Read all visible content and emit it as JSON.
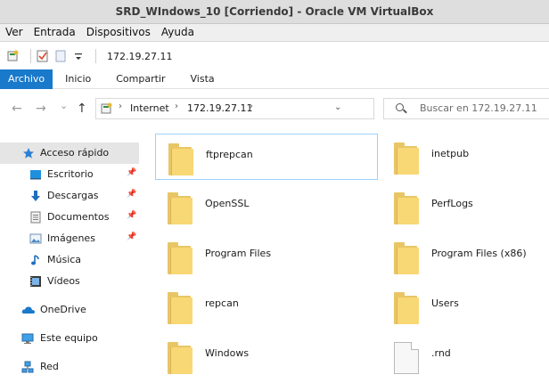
{
  "window": {
    "title": "SRD_WIndows_10 [Corriendo] - Oracle VM VirtualBox"
  },
  "vbox_menu": [
    "Ver",
    "Entrada",
    "Dispositivos",
    "Ayuda"
  ],
  "quick_access": {
    "title": "172.19.27.11",
    "icons": [
      "properties-icon",
      "checkmark-icon",
      "new-folder-icon",
      "customize-dropdown-icon"
    ]
  },
  "ribbon": {
    "tabs": [
      "Archivo",
      "Inicio",
      "Compartir",
      "Vista"
    ],
    "active": "Archivo"
  },
  "navigation": {
    "back": "←",
    "forward": "→",
    "dropdown": "⌄",
    "up": "↑",
    "refresh": "↻"
  },
  "address": {
    "crumbs": [
      "Internet",
      "172.19.27.11"
    ],
    "separator": "›"
  },
  "search": {
    "placeholder": "Buscar en 172.19.27.11"
  },
  "sidebar": {
    "items": [
      {
        "label": "Acceso rápido",
        "icon": "star-icon",
        "selected": true,
        "pinned": false
      },
      {
        "label": "Escritorio",
        "icon": "desktop-icon",
        "pinned": true
      },
      {
        "label": "Descargas",
        "icon": "download-icon",
        "pinned": true
      },
      {
        "label": "Documentos",
        "icon": "documents-icon",
        "pinned": true
      },
      {
        "label": "Imágenes",
        "icon": "pictures-icon",
        "pinned": true
      },
      {
        "label": "Música",
        "icon": "music-icon",
        "pinned": false
      },
      {
        "label": "Vídeos",
        "icon": "videos-icon",
        "pinned": false
      },
      {
        "label": "OneDrive",
        "icon": "cloud-icon",
        "pinned": false
      },
      {
        "label": "Este equipo",
        "icon": "computer-icon",
        "pinned": false
      },
      {
        "label": "Red",
        "icon": "network-icon",
        "pinned": false
      }
    ],
    "pin_glyph": "📌"
  },
  "files": [
    {
      "name": "ftprepcan",
      "type": "folder",
      "focused": true
    },
    {
      "name": "inetpub",
      "type": "folder"
    },
    {
      "name": "OpenSSL",
      "type": "folder"
    },
    {
      "name": "PerfLogs",
      "type": "folder"
    },
    {
      "name": "Program Files",
      "type": "folder"
    },
    {
      "name": "Program Files (x86)",
      "type": "folder"
    },
    {
      "name": "repcan",
      "type": "folder"
    },
    {
      "name": "Users",
      "type": "folder"
    },
    {
      "name": "Windows",
      "type": "folder"
    },
    {
      "name": ".rnd",
      "type": "file"
    }
  ],
  "colors": {
    "accent": "#1979ca",
    "folder": "#f8d775",
    "selection": "#e5e5e5",
    "focus": "#99d1ff"
  }
}
